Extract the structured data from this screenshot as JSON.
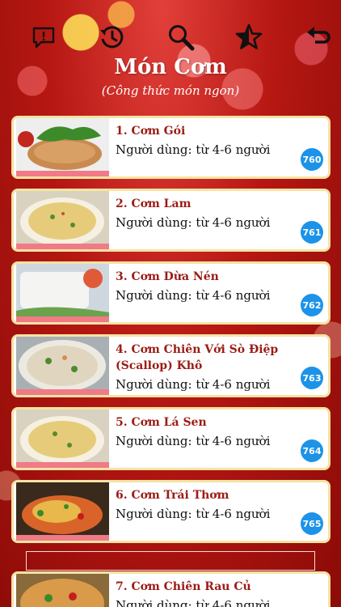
{
  "toolbar": {
    "icons": [
      "report-icon",
      "history-icon",
      "search-icon",
      "favorite-icon",
      "back-icon"
    ]
  },
  "header": {
    "title": "Món Cơm",
    "subtitle": "(Công thức món ngon)"
  },
  "recipes": [
    {
      "title": "1. Cơm Gói",
      "desc": "Người dùng: từ 4-6 người",
      "badge": "760"
    },
    {
      "title": "2. Cơm Lam",
      "desc": "Người dùng: từ 4-6 người",
      "badge": "761"
    },
    {
      "title": "3. Cơm Dừa Nén",
      "desc": "Người dùng: từ 4-6 người",
      "badge": "762"
    },
    {
      "title": "4. Cơm Chiên Với Sò Điệp (Scallop) Khô",
      "desc": "Người dùng: từ 4-6 người",
      "badge": "763"
    },
    {
      "title": "5. Cơm Lá Sen",
      "desc": "Người dùng: từ 4-6 người",
      "badge": "764"
    },
    {
      "title": "6. Cơm Trái Thơm",
      "desc": "Người dùng: từ 4-6 người",
      "badge": "765"
    },
    {
      "title": "7. Cơm Chiên Rau Củ",
      "desc": "Người dùng: từ 4-6 người",
      "badge": ""
    }
  ],
  "colors": {
    "background": "#b61712",
    "card_border": "#f4e3a4",
    "title_text": "#9a1c16",
    "badge": "#1c93e8",
    "thumb_bar": "#f07a86"
  }
}
